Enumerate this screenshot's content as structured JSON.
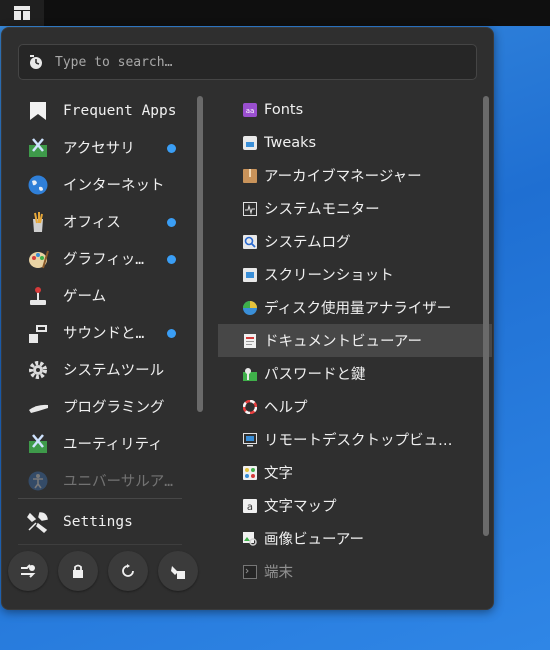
{
  "search": {
    "placeholder": "Type to search…"
  },
  "categories": [
    {
      "label": "Frequent Apps",
      "dot": false
    },
    {
      "label": "アクセサリ",
      "dot": true
    },
    {
      "label": "インターネット",
      "dot": false
    },
    {
      "label": "オフィス",
      "dot": true
    },
    {
      "label": "グラフィッ…",
      "dot": true
    },
    {
      "label": "ゲーム",
      "dot": false
    },
    {
      "label": "サウンドと…",
      "dot": true
    },
    {
      "label": "システムツール",
      "dot": false
    },
    {
      "label": "プログラミング",
      "dot": false
    },
    {
      "label": "ユーティリティ",
      "dot": false
    },
    {
      "label": "ユニバーサルア…",
      "dot": false
    }
  ],
  "settings": {
    "label": "Settings"
  },
  "actions": [
    {
      "icon": "switch-user-icon"
    },
    {
      "icon": "lock-icon"
    },
    {
      "icon": "restart-icon"
    },
    {
      "icon": "logout-icon"
    }
  ],
  "apps": [
    {
      "label": "Fonts",
      "icon": "fonts-icon"
    },
    {
      "label": "Tweaks",
      "icon": "tweaks-icon"
    },
    {
      "label": "アーカイブマネージャー",
      "icon": "archive-icon"
    },
    {
      "label": "システムモニター",
      "icon": "monitor-icon"
    },
    {
      "label": "システムログ",
      "icon": "log-icon"
    },
    {
      "label": "スクリーンショット",
      "icon": "screenshot-icon"
    },
    {
      "label": "ディスク使用量アナライザー",
      "icon": "disk-usage-icon"
    },
    {
      "label": "ドキュメントビューアー",
      "icon": "document-viewer-icon"
    },
    {
      "label": "パスワードと鍵",
      "icon": "passwords-icon"
    },
    {
      "label": "ヘルプ",
      "icon": "help-icon"
    },
    {
      "label": "リモートデスクトップビュ…",
      "icon": "remote-desktop-icon"
    },
    {
      "label": "文字",
      "icon": "characters-icon"
    },
    {
      "label": "文字マップ",
      "icon": "character-map-icon"
    },
    {
      "label": "画像ビューアー",
      "icon": "image-viewer-icon"
    },
    {
      "label": "端末",
      "icon": "terminal-icon"
    }
  ],
  "colors": {
    "accent_dot": "#3a9ef5",
    "selected_bg": "#474747",
    "panel_bg": "#2f2f2f"
  }
}
